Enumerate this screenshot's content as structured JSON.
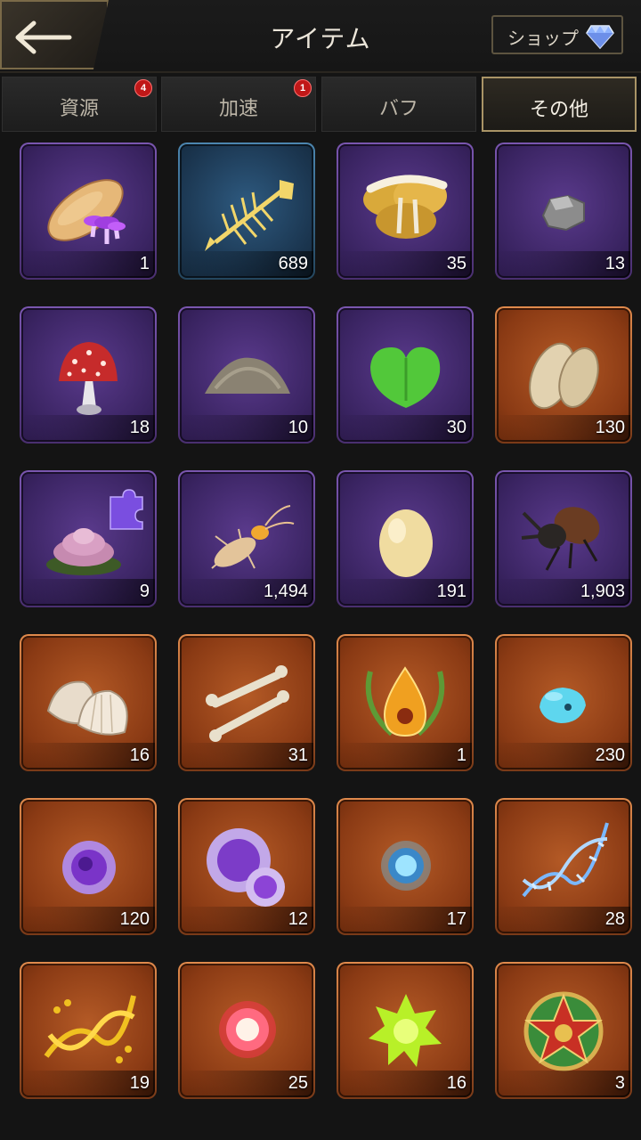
{
  "header": {
    "title": "アイテム",
    "shop_label": "ショップ"
  },
  "tabs": [
    {
      "label": "資源",
      "badge": "4",
      "active": false
    },
    {
      "label": "加速",
      "badge": "1",
      "active": false
    },
    {
      "label": "バフ",
      "badge": null,
      "active": false
    },
    {
      "label": "その他",
      "badge": null,
      "active": true
    }
  ],
  "items": [
    {
      "icon": "bread-and-mushroom-icon",
      "count": "1",
      "rarity": "purple"
    },
    {
      "icon": "fish-skeleton-icon",
      "count": "689",
      "rarity": "blue"
    },
    {
      "icon": "oyster-mushroom-icon",
      "count": "35",
      "rarity": "purple"
    },
    {
      "icon": "stone-icon",
      "count": "13",
      "rarity": "purple"
    },
    {
      "icon": "red-mushroom-icon",
      "count": "18",
      "rarity": "purple"
    },
    {
      "icon": "dirt-pile-icon",
      "count": "10",
      "rarity": "purple"
    },
    {
      "icon": "green-leaf-icon",
      "count": "30",
      "rarity": "purple"
    },
    {
      "icon": "potatoes-icon",
      "count": "130",
      "rarity": "orange"
    },
    {
      "icon": "succulent-puzzle-icon",
      "count": "9",
      "rarity": "purple"
    },
    {
      "icon": "termite-icon",
      "count": "1,494",
      "rarity": "purple"
    },
    {
      "icon": "egg-icon",
      "count": "191",
      "rarity": "purple"
    },
    {
      "icon": "beetle-icon",
      "count": "1,903",
      "rarity": "purple"
    },
    {
      "icon": "shells-icon",
      "count": "16",
      "rarity": "orange"
    },
    {
      "icon": "bones-icon",
      "count": "31",
      "rarity": "orange"
    },
    {
      "icon": "laurel-drop-emblem-icon",
      "count": "1",
      "rarity": "orange"
    },
    {
      "icon": "blue-crystal-icon",
      "count": "230",
      "rarity": "orange"
    },
    {
      "icon": "purple-cell-icon",
      "count": "120",
      "rarity": "orange"
    },
    {
      "icon": "purple-cells-icon",
      "count": "12",
      "rarity": "orange"
    },
    {
      "icon": "blue-orb-icon",
      "count": "17",
      "rarity": "orange"
    },
    {
      "icon": "blue-dna-icon",
      "count": "28",
      "rarity": "orange"
    },
    {
      "icon": "gold-dna-icon",
      "count": "19",
      "rarity": "orange"
    },
    {
      "icon": "red-cell-icon",
      "count": "25",
      "rarity": "orange"
    },
    {
      "icon": "green-spiky-cell-icon",
      "count": "16",
      "rarity": "orange"
    },
    {
      "icon": "star-medal-icon",
      "count": "3",
      "rarity": "orange"
    }
  ]
}
